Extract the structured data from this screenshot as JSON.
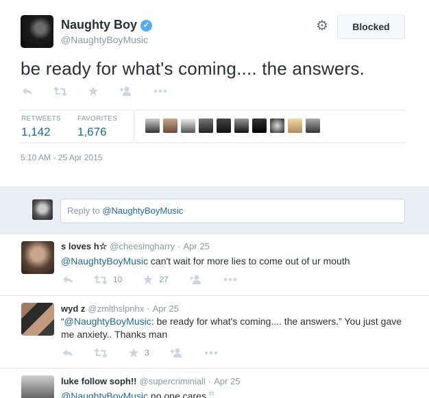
{
  "tweet": {
    "name": "Naughty Boy",
    "handle": "@NaughtyBoyMusic",
    "blocked_label": "Blocked",
    "text": "be ready for what's coming.... the answers.",
    "retweets_label": "RETWEETS",
    "retweets_count": "1,142",
    "favorites_label": "FAVORITES",
    "favorites_count": "1,676",
    "timestamp": "5:10 AM - 25 Apr 2015",
    "favoriter_count_shown": 10
  },
  "reply_box": {
    "prefix": "Reply to ",
    "mention": "@NaughtyBoyMusic"
  },
  "replies": [
    {
      "name": "s loves h☆",
      "handle": "@cheesingharry",
      "date": "Apr 25",
      "mention": "@NaughtyBoyMusic",
      "text": " can't wait for more lies to come out of ur mouth",
      "retweets": "10",
      "favorites": "27"
    },
    {
      "name": "wyd z",
      "handle": "@zmlthslpnhx",
      "date": "Apr 25",
      "quote_open": "“",
      "mention": "@NaughtyBoyMusic",
      "text": ": be ready for what's coming.... the answers.” You just gave me anxiety.. Thanks man",
      "retweets": "",
      "favorites": "3"
    },
    {
      "name": "luke follow soph!!",
      "handle": "@supercriminiall",
      "date": "Apr 25",
      "mention": "@NaughtyBoyMusic",
      "text": " no one cares",
      "zz": "ᶻᶻ"
    }
  ],
  "colors": {
    "link": "#1a6a9f",
    "muted": "#8899a6",
    "verified": "#55acee",
    "reply_bg": "#e9eff4"
  },
  "icons": [
    "verified-icon",
    "gear-icon",
    "reply-icon",
    "retweet-icon",
    "favorite-icon",
    "follow-icon",
    "more-icon"
  ]
}
